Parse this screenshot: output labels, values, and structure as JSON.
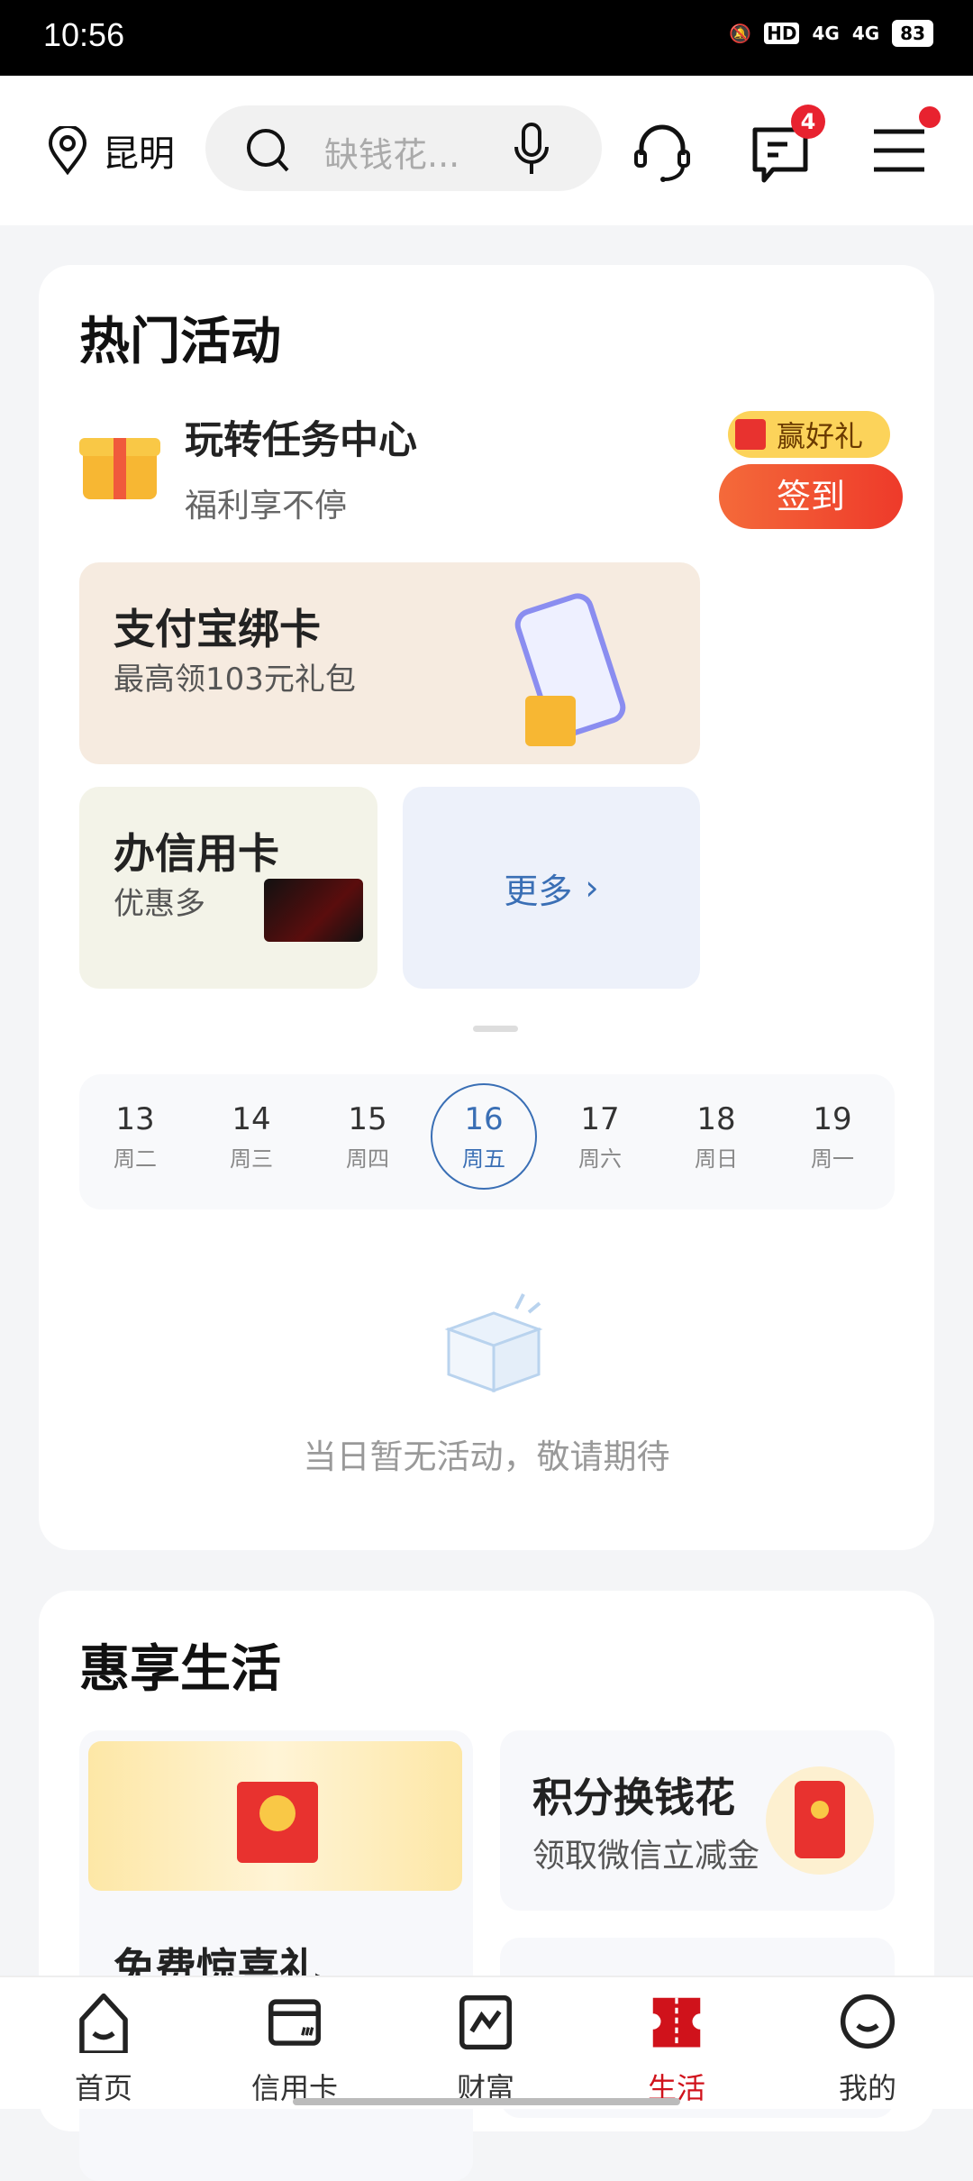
{
  "status_bar": {
    "time": "10:56",
    "battery": "83",
    "network": "4G"
  },
  "header": {
    "location": "昆明",
    "search_placeholder": "缺钱花...",
    "message_badge": "4"
  },
  "hot": {
    "title": "热门活动",
    "task": {
      "title": "玩转任务中心",
      "subtitle": "福利享不停",
      "badge": "赢好礼",
      "button": "签到"
    },
    "alipay": {
      "title": "支付宝绑卡",
      "subtitle": "最高领103元礼包"
    },
    "credit": {
      "title": "办信用卡",
      "subtitle": "优惠多"
    },
    "more": "更多",
    "dates": [
      {
        "d": "13",
        "w": "周二"
      },
      {
        "d": "14",
        "w": "周三"
      },
      {
        "d": "15",
        "w": "周四"
      },
      {
        "d": "16",
        "w": "周五"
      },
      {
        "d": "17",
        "w": "周六"
      },
      {
        "d": "18",
        "w": "周日"
      },
      {
        "d": "19",
        "w": "周一"
      }
    ],
    "selected_date": "16",
    "empty": "当日暂无活动，敬请期待"
  },
  "life": {
    "title": "惠享生活",
    "left_tile_title": "免费惊喜礼",
    "points": {
      "title": "积分换钱花",
      "subtitle": "领取微信立减金"
    }
  },
  "tabs": [
    {
      "label": "首页"
    },
    {
      "label": "信用卡"
    },
    {
      "label": "财富"
    },
    {
      "label": "生活",
      "active": true
    },
    {
      "label": "我的"
    }
  ],
  "colors": {
    "accent": "#d0121b",
    "blue": "#3a6fb5",
    "button": "#f0452e"
  }
}
